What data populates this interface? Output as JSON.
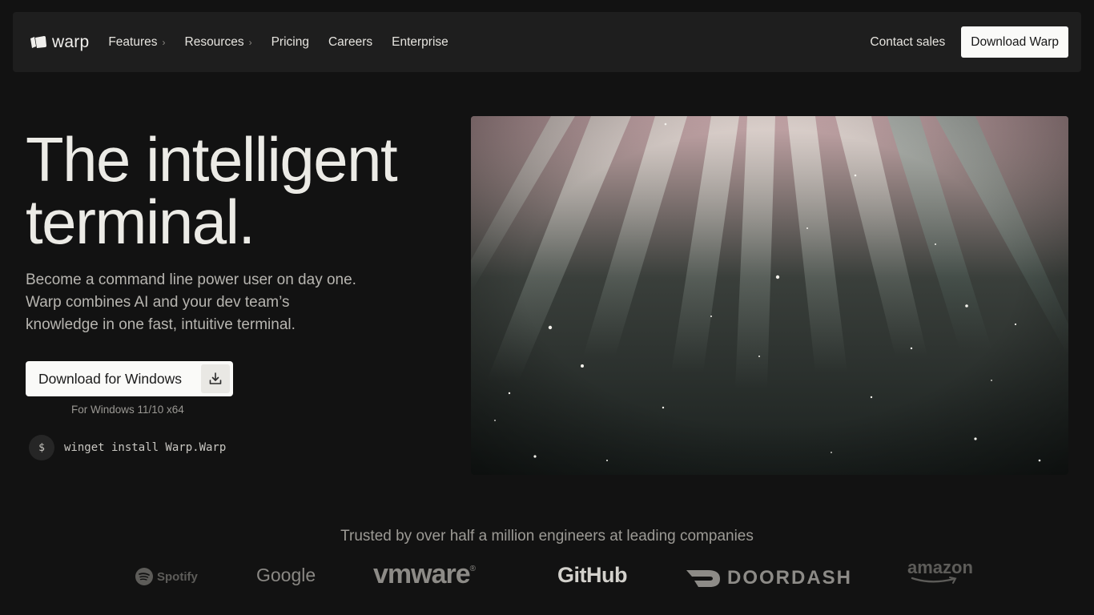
{
  "nav": {
    "logo_text": "warp",
    "links": [
      {
        "label": "Features",
        "has_chevron": true
      },
      {
        "label": "Resources",
        "has_chevron": true
      },
      {
        "label": "Pricing",
        "has_chevron": false
      },
      {
        "label": "Careers",
        "has_chevron": false
      },
      {
        "label": "Enterprise",
        "has_chevron": false
      }
    ],
    "contact_label": "Contact sales",
    "download_label": "Download Warp"
  },
  "hero": {
    "title_line1": "The intelligent",
    "title_line2": "terminal.",
    "subtitle": "Become a command line power user on day one. Warp combines AI and your dev team’s knowledge in one fast, intuitive terminal.",
    "download_button": "Download for Windows",
    "download_icon": "download-icon",
    "platform_note": "For Windows 11/10 x64",
    "cmd_prompt": "$",
    "cmd_text": "winget install Warp.Warp"
  },
  "trusted": {
    "heading": "Trusted by over half a million engineers at leading companies",
    "logos": [
      "Spotify",
      "Google",
      "vmware",
      "GitHub",
      "DOORDASH",
      "amazon"
    ]
  },
  "colors": {
    "background": "#121212",
    "nav_bg": "#1e1e1e",
    "button_bg": "#fafaf8",
    "text_primary": "#ecebe6",
    "text_muted": "#9c9a95"
  }
}
